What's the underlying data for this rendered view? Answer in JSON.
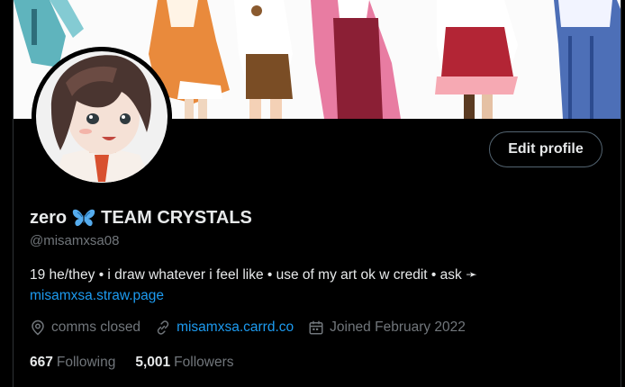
{
  "profile": {
    "display_name": "zero",
    "name_suffix": "TEAM CRYSTALS",
    "emoji": "butterfly-emoji",
    "handle": "@misamxsa08",
    "edit_button_label": "Edit profile",
    "bio_text": "19 he/they • i draw whatever i feel like • use of my art ok w credit • ask ➛",
    "bio_link": "misamxsa.straw.page",
    "location": "comms closed",
    "website": "misamxsa.carrd.co",
    "joined": "Joined February 2022",
    "following_count": "667",
    "following_label": "Following",
    "followers_count": "5,001",
    "followers_label": "Followers"
  },
  "icons": {
    "location": "location-pin-icon",
    "website": "link-icon",
    "joined": "calendar-icon"
  },
  "colors": {
    "background": "#000000",
    "text": "#e7e9ea",
    "muted": "#71767b",
    "link": "#1d9bf0",
    "border": "#536471"
  }
}
